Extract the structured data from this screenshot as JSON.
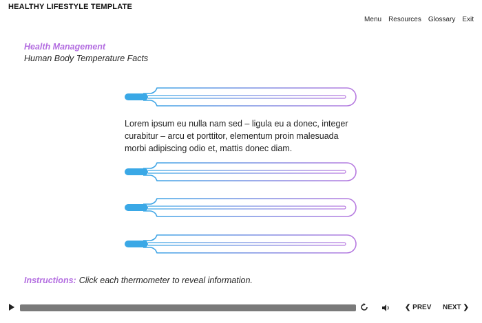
{
  "header": {
    "course_title": "HEALTHY LIFESTYLE TEMPLATE"
  },
  "nav": {
    "menu": "Menu",
    "resources": "Resources",
    "glossary": "Glossary",
    "exit": "Exit"
  },
  "slide": {
    "section_title": "Health Management",
    "subtitle": "Human Body Temperature Facts",
    "info_text": "Lorem ipsum eu nulla nam sed – ligula eu a donec, integer curabitur – arcu et porttitor, elementum proin malesuada morbi adipiscing odio et, mattis donec diam.",
    "instructions_label": "Instructions:",
    "instructions_text": "Click each thermometer to reveal information."
  },
  "thermometers_count": 4,
  "colors": {
    "accent": "#b36de0",
    "thermo_blue": "#3aa8e6",
    "thermo_purple": "#b87be0",
    "seek": "#7a7a7a"
  },
  "player": {
    "prev_label": "❮ PREV",
    "next_label": "NEXT ❯",
    "icons": [
      "play-icon",
      "replay-icon",
      "volume-icon"
    ]
  }
}
